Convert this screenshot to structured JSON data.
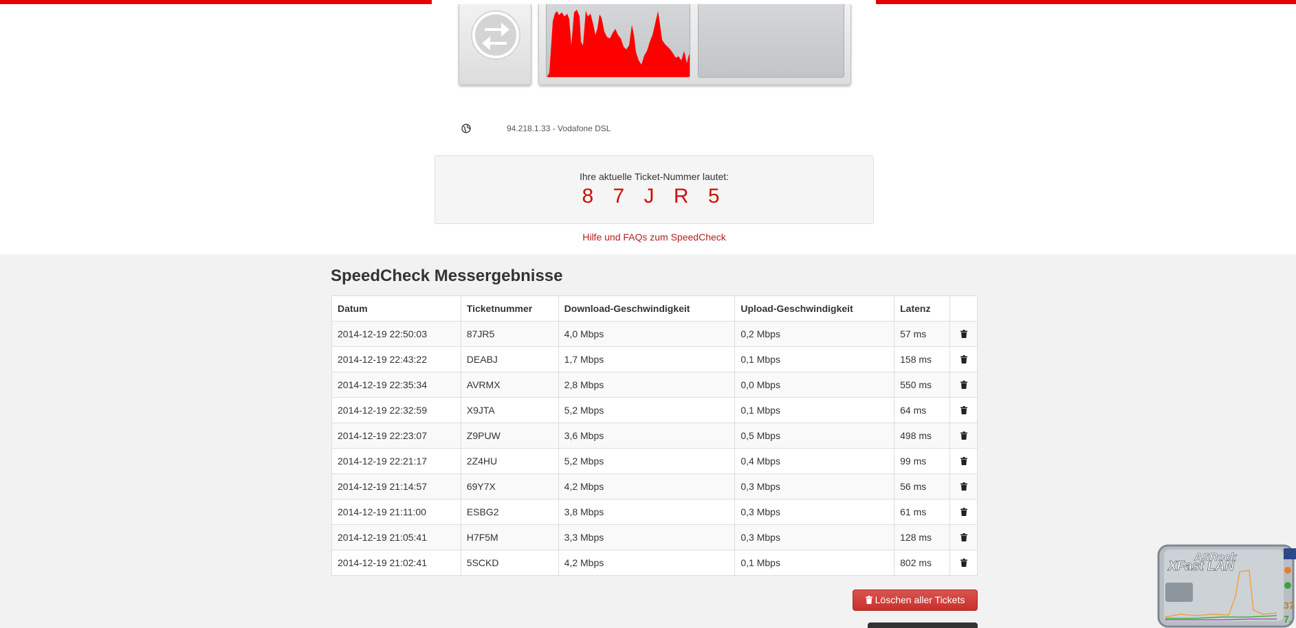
{
  "connection": {
    "ip_provider": "94.218.1.33 - Vodafone DSL"
  },
  "ticket": {
    "label": "Ihre aktuelle Ticket-Nummer lautet:",
    "number": "8 7 J R 5"
  },
  "help_link": "Hilfe und FAQs zum SpeedCheck",
  "results": {
    "title": "SpeedCheck Messergebnisse",
    "columns": [
      "Datum",
      "Ticketnummer",
      "Download-Geschwindigkeit",
      "Upload-Geschwindigkeit",
      "Latenz",
      ""
    ],
    "rows": [
      [
        "2014-12-19 22:50:03",
        "87JR5",
        "4,0 Mbps",
        "0,2 Mbps",
        "57 ms"
      ],
      [
        "2014-12-19 22:43:22",
        "DEABJ",
        "1,7 Mbps",
        "0,1 Mbps",
        "158 ms"
      ],
      [
        "2014-12-19 22:35:34",
        "AVRMX",
        "2,8 Mbps",
        "0,0 Mbps",
        "550 ms"
      ],
      [
        "2014-12-19 22:32:59",
        "X9JTA",
        "5,2 Mbps",
        "0,1 Mbps",
        "64 ms"
      ],
      [
        "2014-12-19 22:23:07",
        "Z9PUW",
        "3,6 Mbps",
        "0,5 Mbps",
        "498 ms"
      ],
      [
        "2014-12-19 22:21:17",
        "2Z4HU",
        "5,2 Mbps",
        "0,4 Mbps",
        "99 ms"
      ],
      [
        "2014-12-19 21:14:57",
        "69Y7X",
        "4,2 Mbps",
        "0,3 Mbps",
        "56 ms"
      ],
      [
        "2014-12-19 21:11:00",
        "ESBG2",
        "3,8 Mbps",
        "0,3 Mbps",
        "61 ms"
      ],
      [
        "2014-12-19 21:05:41",
        "H7F5M",
        "3,3 Mbps",
        "0,3 Mbps",
        "128 ms"
      ],
      [
        "2014-12-19 21:02:41",
        "5SCKD",
        "4,2 Mbps",
        "0,1 Mbps",
        "802 ms"
      ]
    ],
    "delete_all_label": "Löschen aller Tickets"
  },
  "overlay_widget": {
    "brand": "ASRock",
    "product": "XFast LAN",
    "values": [
      "37",
      "7."
    ]
  },
  "colors": {
    "accent_red": "#e60000",
    "ticket_red": "#cc1100",
    "link_red": "#b71c1c",
    "danger_button": "#d9534f"
  }
}
